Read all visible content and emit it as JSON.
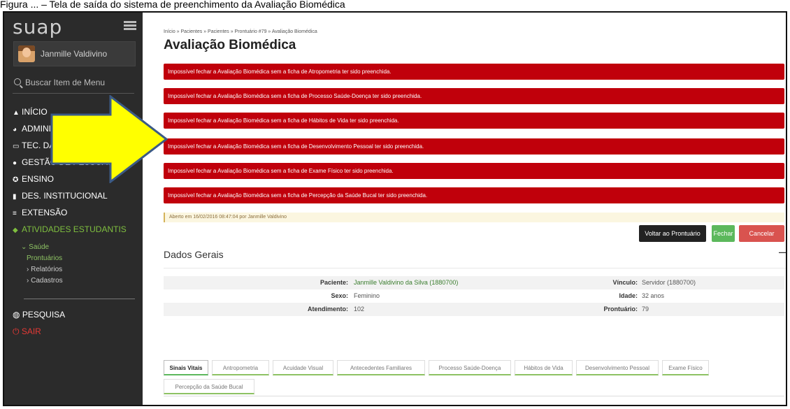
{
  "caption": "Figura ... – Tela de saída do sistema de preenchimento da Avaliação Biomédica",
  "sidebar": {
    "logo": "suap",
    "user": "Janmille Valdivino",
    "search_placeholder": "Buscar Item de Menu",
    "menu": [
      {
        "label": "INÍCIO",
        "icon": "home-icon"
      },
      {
        "label": "ADMINISTRAÇÃO",
        "icon": "pie-chart-icon"
      },
      {
        "label": "TEC. DA INFORMAÇÃO",
        "icon": "monitor-icon"
      },
      {
        "label": "GESTÃO DE PESSOAS",
        "icon": "user-icon"
      },
      {
        "label": "ENSINO",
        "icon": "badge-icon"
      },
      {
        "label": "DES. INSTITUCIONAL",
        "icon": "bar-chart-icon"
      },
      {
        "label": "EXTENSÃO",
        "icon": "list-icon"
      },
      {
        "label": "ATIVIDADES ESTUDANTIS",
        "icon": "graduation-cap-icon"
      }
    ],
    "submenu": {
      "saude": "Saúde",
      "prontuarios": "Prontuários",
      "relatorios": "Relatórios",
      "cadastros": "Cadastros"
    },
    "menu2": [
      {
        "label": "PESQUISA",
        "icon": "globe-icon"
      },
      {
        "label": "SAIR",
        "icon": "power-icon"
      }
    ]
  },
  "breadcrumb": "Início » Pacientes » Pacientes » Prontuário #79 » Avaliação Biomédica",
  "page_title": "Avaliação Biomédica",
  "alerts": [
    "Impossível fechar a Avaliação Biomédica sem a ficha de Atropometria ter sido preenchida.",
    "Impossível fechar a Avaliação Biomédica sem a ficha de Processo Saúde-Doença ter sido preenchida.",
    "Impossível fechar a Avaliação Biomédica sem a ficha de Hábitos de Vida ter sido preenchida.",
    "Impossível fechar a Avaliação Biomédica sem a ficha de Desenvolvimento Pessoal ter sido preenchida.",
    "Impossível fechar a Avaliação Biomédica sem a ficha de Exame Físico ter sido preenchida.",
    "Impossível fechar a Avaliação Biomédica sem a ficha de Percepção da Saúde Bucal ter sido preenchida."
  ],
  "info": "Aberto em 16/02/2016 08:47:04 por Janmille Valdivino",
  "buttons": {
    "voltar": "Voltar ao Prontuário",
    "fechar": "Fechar",
    "cancelar": "Cancelar"
  },
  "section": {
    "title": "Dados Gerais",
    "collapse": "–"
  },
  "fields": {
    "paciente_label": "Paciente:",
    "paciente": "Janmille Valdivino da Silva (1880700)",
    "vinculo_label": "Vínculo:",
    "vinculo": "Servidor (1880700)",
    "sexo_label": "Sexo:",
    "sexo": "Feminino",
    "idade_label": "Idade:",
    "idade": "32 anos",
    "atendimento_label": "Atendimento:",
    "atendimento": "102",
    "prontuario_label": "Prontuário:",
    "prontuario": "79"
  },
  "tabs": [
    "Sinais Vitais",
    "Antropometria",
    "Acuidade Visual",
    "Antecedentes Familiares",
    "Processo Saúde-Doença",
    "Hábitos de Vida",
    "Desenvolvimento Pessoal",
    "Exame Físico",
    "Percepção da Saúde Bucal"
  ],
  "colors": {
    "alert": "#c0000b",
    "accent": "#8dc263",
    "arrow": "#ffff00"
  }
}
